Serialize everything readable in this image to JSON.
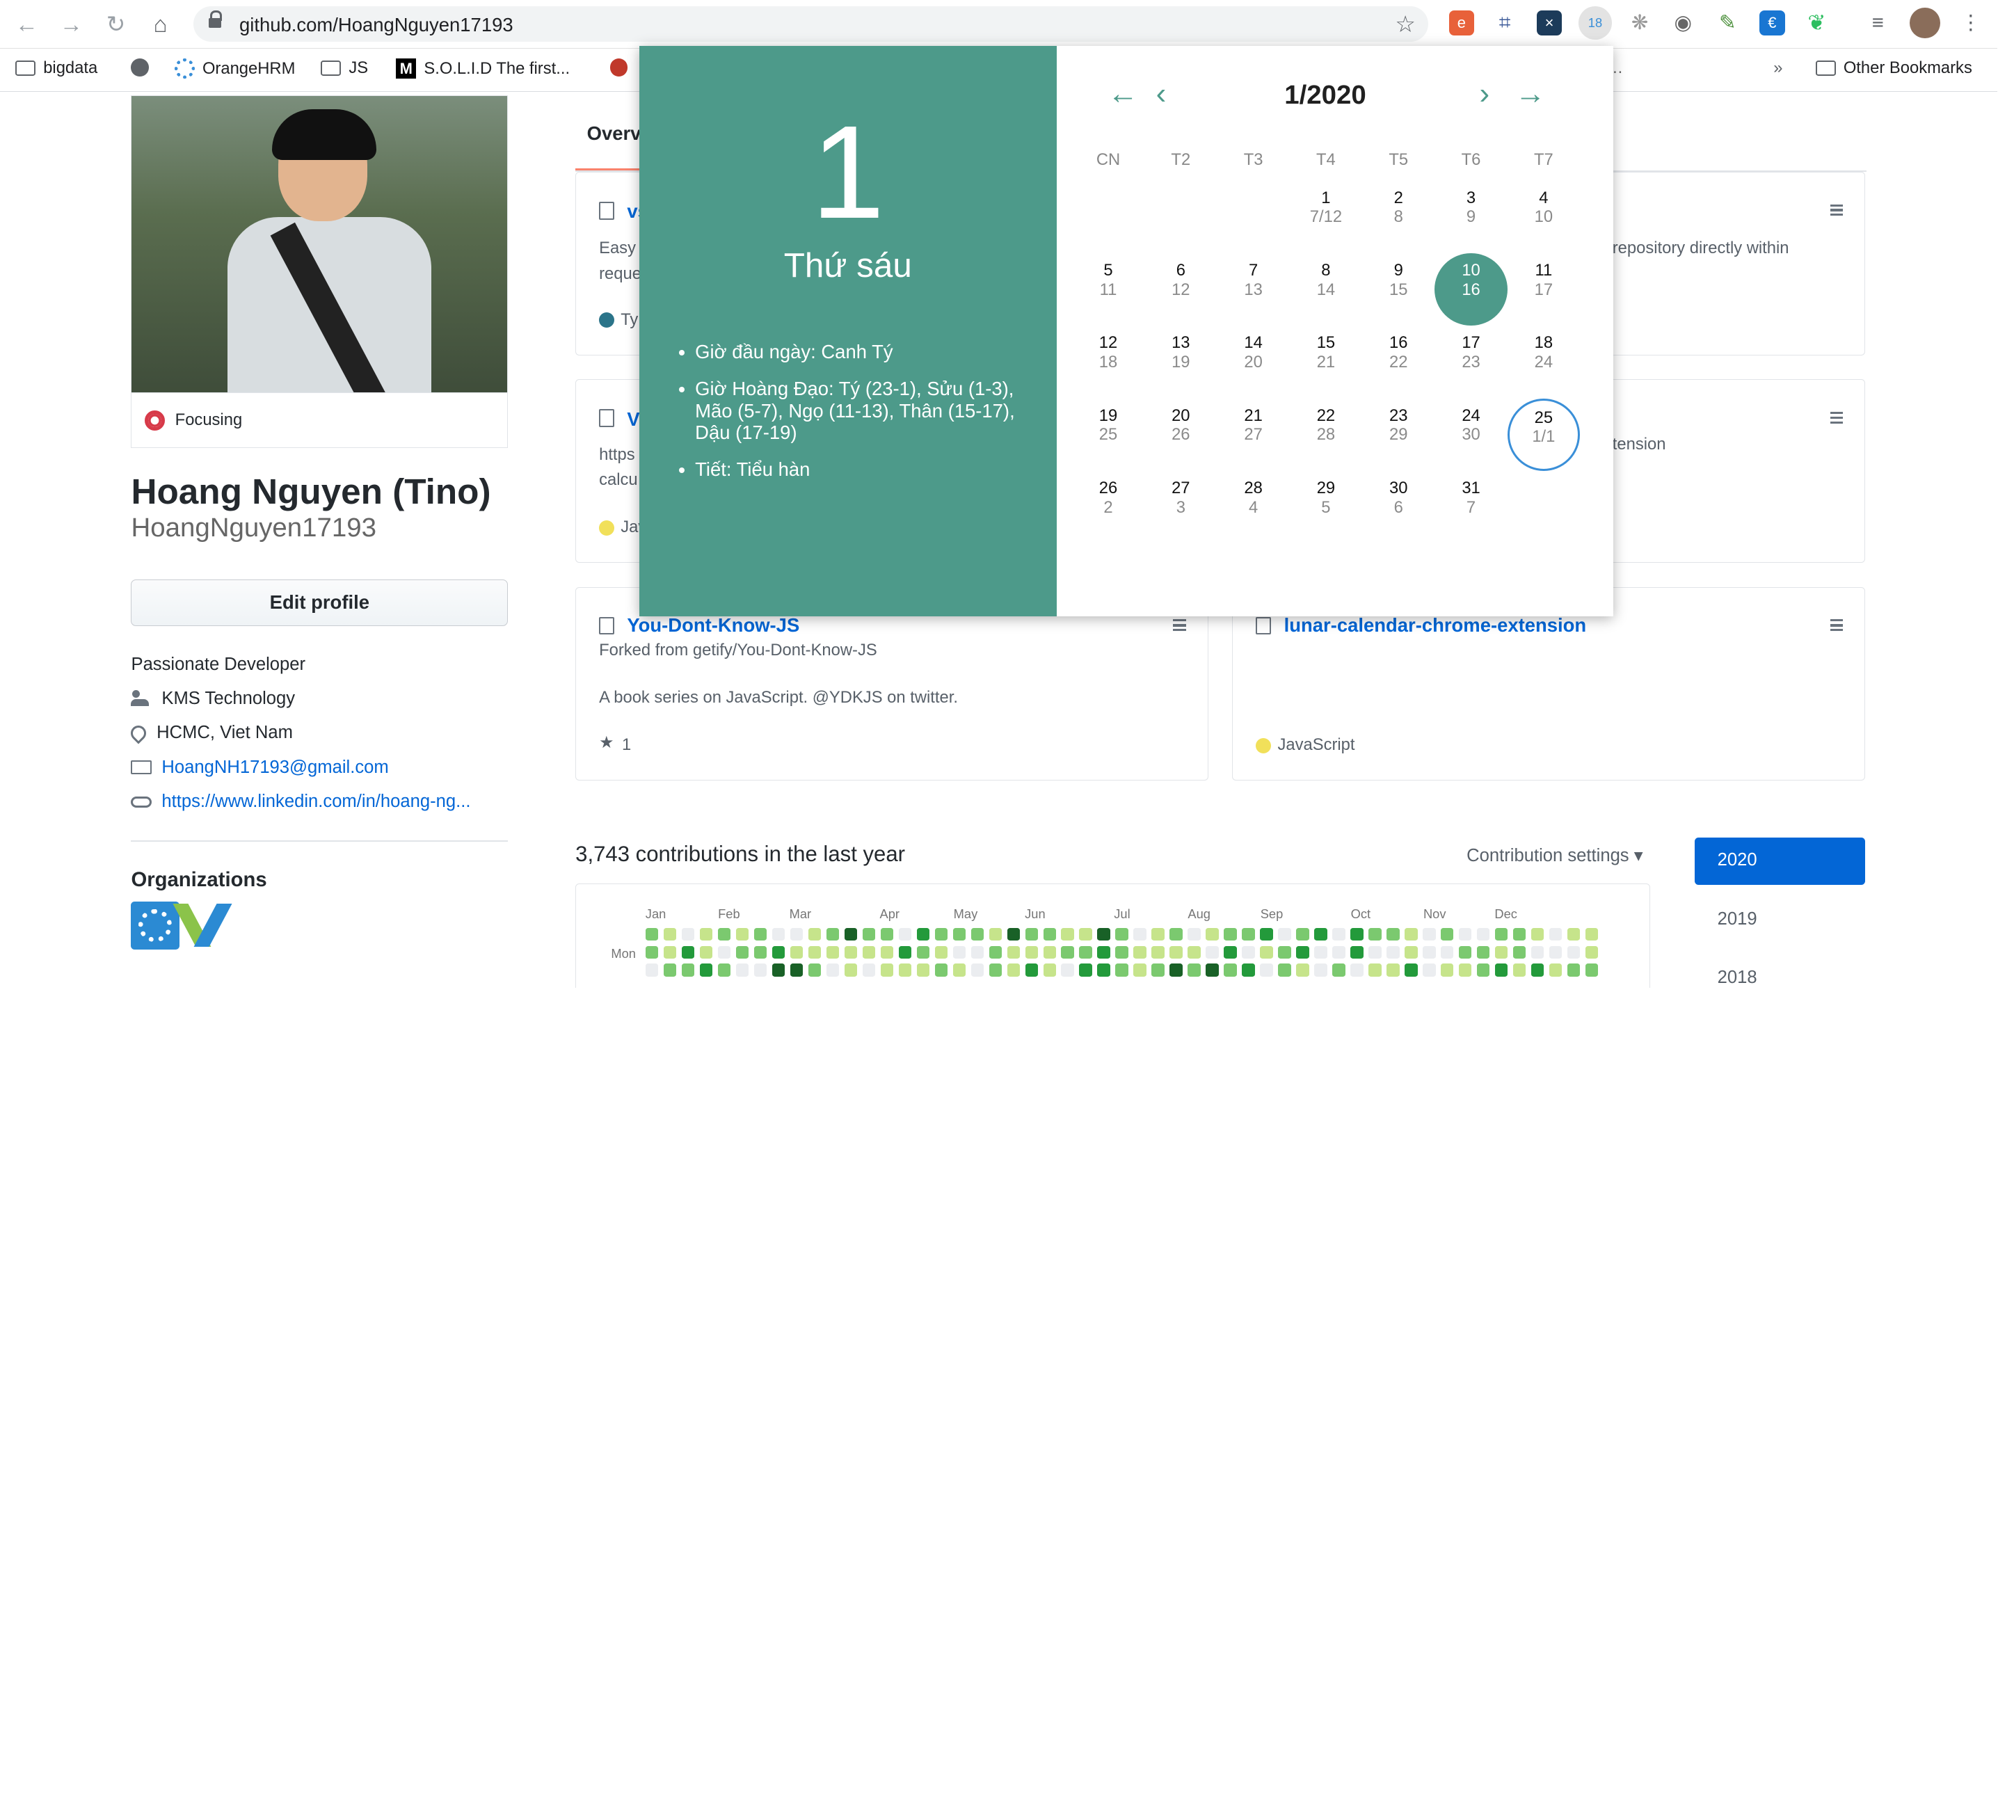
{
  "browser": {
    "url_prefix": "github.com/",
    "url_path": "HoangNguyen17193",
    "bookmarks": [
      "bigdata",
      "OrangeHRM",
      "JS",
      "S.O.L.I.D The first...",
      "Other Bookmarks"
    ],
    "overflow": "»",
    "ext_badge": "18"
  },
  "profile": {
    "status": "Focusing",
    "name": "Hoang Nguyen (Tino)",
    "username": "HoangNguyen17193",
    "edit_label": "Edit profile",
    "bio": "Passionate Developer",
    "company": "KMS Technology",
    "location": "HCMC, Viet Nam",
    "email": "HoangNH17193@gmail.com",
    "website": "https://www.linkedin.com/in/hoang-ng...",
    "organizations_title": "Organizations"
  },
  "tabs": {
    "overview": "Overview"
  },
  "cards": [
    {
      "name": "vs",
      "desc": "Easy",
      "desc2": "reque",
      "lang": "Ty",
      "lang_color": "#2b7489"
    },
    {
      "name": "",
      "desc": "repository directly within",
      "desc2": "",
      "lang": "",
      "lang_color": ""
    },
    {
      "name": "V",
      "desc": "https",
      "desc2": "calcu",
      "lang": "Jav",
      "lang_color": "#f1e05a"
    },
    {
      "name": "",
      "desc": "tension",
      "desc2": "",
      "lang": "",
      "lang_color": ""
    },
    {
      "name": "You-Dont-Know-JS",
      "desc": "Forked from getify/You-Dont-Know-JS",
      "desc2": "A book series on JavaScript. @YDKJS on twitter.",
      "stars": "1"
    },
    {
      "name": "lunar-calendar-chrome-extension",
      "desc": "",
      "desc2": "",
      "lang": "JavaScript",
      "lang_color": "#f1e05a"
    }
  ],
  "contributions": {
    "title": "3,743 contributions in the last year",
    "settings": "Contribution settings ▾",
    "months": [
      "Jan",
      "Feb",
      "Mar",
      "Apr",
      "May",
      "Jun",
      "Jul",
      "Aug",
      "Sep",
      "Oct",
      "Nov",
      "Dec"
    ],
    "day_label": "Mon",
    "years": [
      "2020",
      "2019",
      "2018"
    ]
  },
  "calendar": {
    "big_day": "1",
    "weekday": "Thứ sáu",
    "info": [
      "Giờ đầu ngày: Canh Tý",
      "Giờ Hoàng Đạo: Tý (23-1), Sửu (1-3), Mão (5-7), Ngọ (11-13), Thân (15-17), Dậu (17-19)",
      "Tiết: Tiểu hàn"
    ],
    "month_title": "1/2020",
    "weekday_headers": [
      "CN",
      "T2",
      "T3",
      "T4",
      "T5",
      "T6",
      "T7"
    ],
    "weeks": [
      [
        null,
        null,
        null,
        {
          "s": "1",
          "l": "7/12"
        },
        {
          "s": "2",
          "l": "8"
        },
        {
          "s": "3",
          "l": "9"
        },
        {
          "s": "4",
          "l": "10"
        }
      ],
      [
        {
          "s": "5",
          "l": "11"
        },
        {
          "s": "6",
          "l": "12"
        },
        {
          "s": "7",
          "l": "13"
        },
        {
          "s": "8",
          "l": "14"
        },
        {
          "s": "9",
          "l": "15"
        },
        {
          "s": "10",
          "l": "16",
          "selected": true
        },
        {
          "s": "11",
          "l": "17"
        }
      ],
      [
        {
          "s": "12",
          "l": "18"
        },
        {
          "s": "13",
          "l": "19"
        },
        {
          "s": "14",
          "l": "20"
        },
        {
          "s": "15",
          "l": "21"
        },
        {
          "s": "16",
          "l": "22"
        },
        {
          "s": "17",
          "l": "23"
        },
        {
          "s": "18",
          "l": "24"
        }
      ],
      [
        {
          "s": "19",
          "l": "25"
        },
        {
          "s": "20",
          "l": "26"
        },
        {
          "s": "21",
          "l": "27"
        },
        {
          "s": "22",
          "l": "28"
        },
        {
          "s": "23",
          "l": "29"
        },
        {
          "s": "24",
          "l": "30"
        },
        {
          "s": "25",
          "l": "1/1",
          "marked": true
        }
      ],
      [
        {
          "s": "26",
          "l": "2"
        },
        {
          "s": "27",
          "l": "3"
        },
        {
          "s": "28",
          "l": "4"
        },
        {
          "s": "29",
          "l": "5"
        },
        {
          "s": "30",
          "l": "6"
        },
        {
          "s": "31",
          "l": "7"
        },
        null
      ]
    ]
  },
  "colors": {
    "calendar_accent": "#4d9a8a",
    "link": "#0366d6",
    "marked_ring": "#3a8fd8"
  }
}
